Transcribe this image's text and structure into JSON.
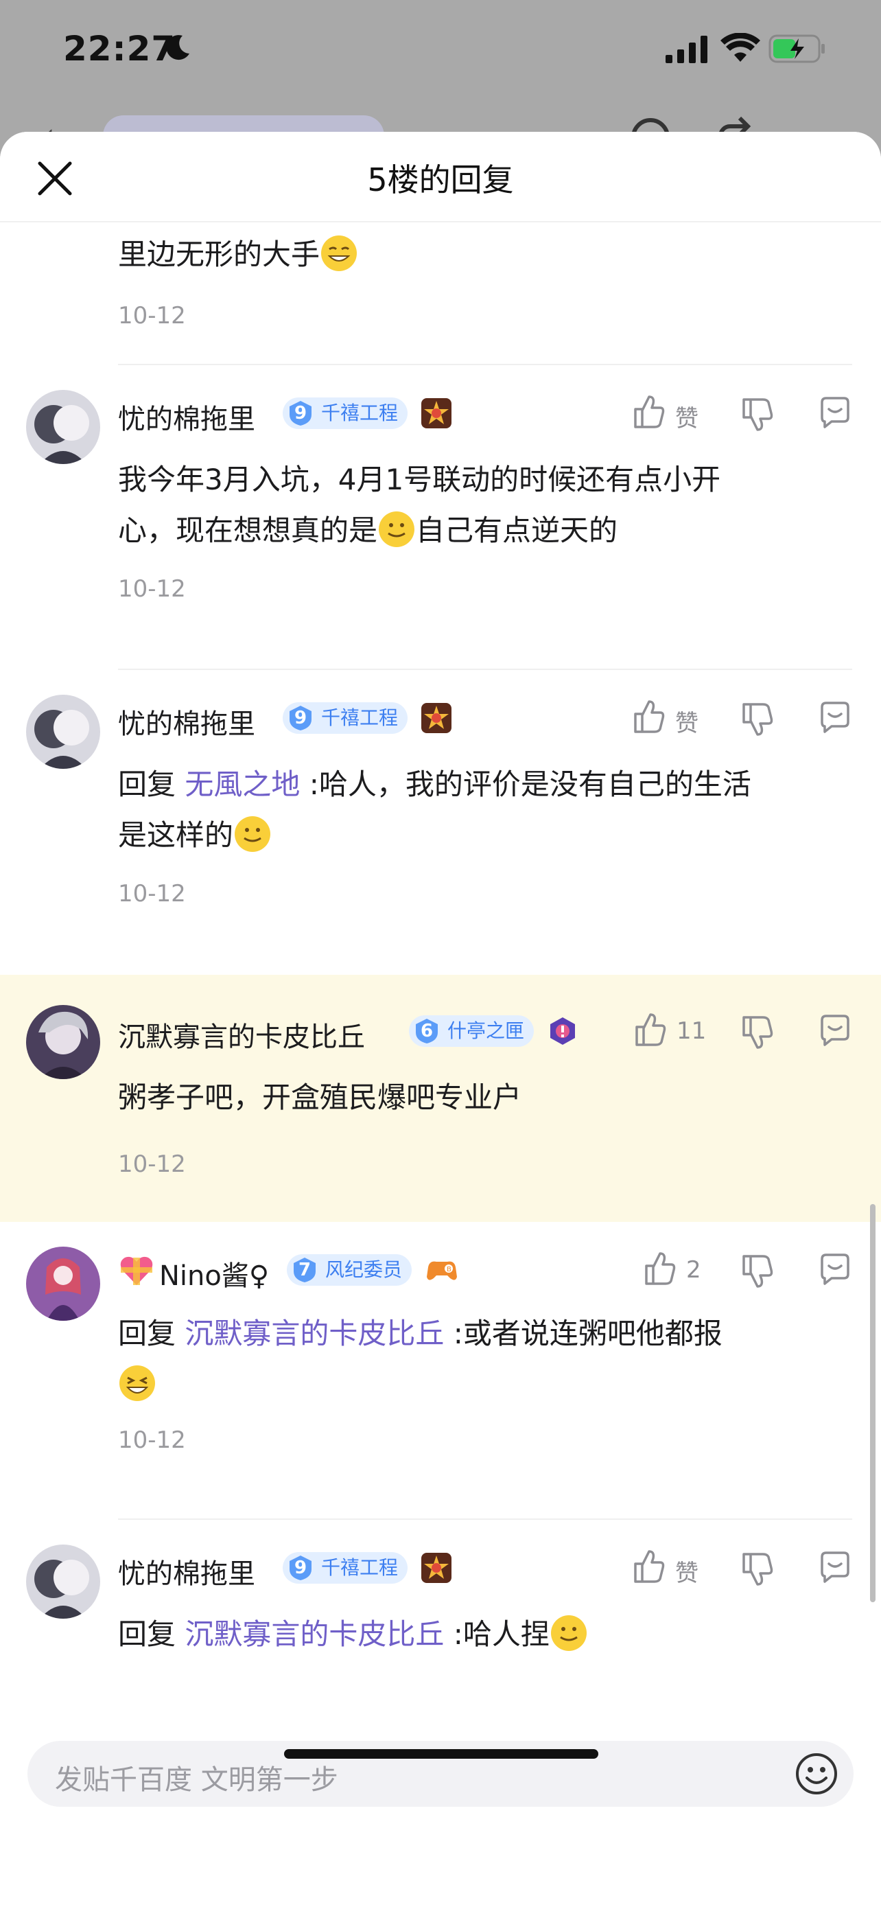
{
  "status_bar": {
    "time": "22:27"
  },
  "sheet": {
    "title": "5楼的回复"
  },
  "partial_item": {
    "text": "里边无形的大手",
    "date": "10-12"
  },
  "replies": [
    {
      "username": "忧的棉拖里",
      "level": "9",
      "title": "千禧工程",
      "like_label": "赞",
      "prefix": "我今年3月入坑，4月1号联动的时候还有点小开",
      "line2_a": "心，现在想想真的是",
      "line2_b": "自己有点逆天的",
      "date": "10-12"
    },
    {
      "username": "忧的棉拖里",
      "level": "9",
      "title": "千禧工程",
      "like_label": "赞",
      "reply_word": "回复",
      "reply_to": "无風之地",
      "line1_rest": ":哈人，我的评价是没有自己的生活",
      "line2": "是这样的",
      "date": "10-12"
    },
    {
      "username": "沉默寡言的卡皮比丘",
      "level": "6",
      "title": "什亭之匣",
      "like_count": "11",
      "text": "粥孝子吧，开盒殖民爆吧专业户",
      "date": "10-12"
    },
    {
      "username": "Nino酱♀",
      "level": "7",
      "title": "风纪委员",
      "like_count": "2",
      "reply_word": "回复",
      "reply_to": "沉默寡言的卡皮比丘",
      "line1_rest": ":或者说连粥吧他都报",
      "date": "10-12"
    },
    {
      "username": "忧的棉拖里",
      "level": "9",
      "title": "千禧工程",
      "like_label": "赞",
      "reply_word": "回复",
      "reply_to": "沉默寡言的卡皮比丘",
      "line1_rest": ":哈人捏"
    }
  ],
  "input": {
    "placeholder": "发贴千百度 文明第一步"
  },
  "colors": {
    "link": "#6f5fc8",
    "highlight": "#fdf9e4",
    "level_bg": "#e3efff",
    "level_fg": "#3d7ff0"
  }
}
